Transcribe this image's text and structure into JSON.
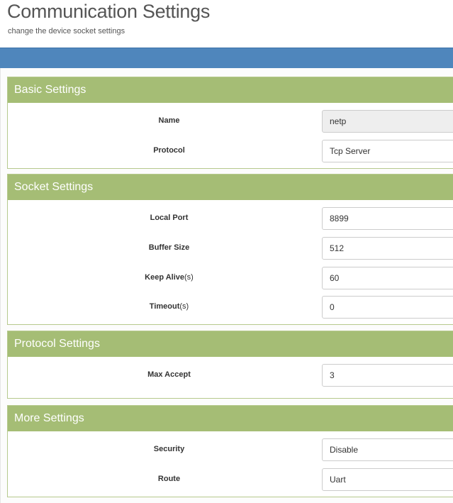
{
  "header": {
    "title": "Communication Settings",
    "subtitle": "change the device socket settings"
  },
  "basic": {
    "title": "Basic Settings",
    "name_label": "Name",
    "name_value": "netp",
    "protocol_label": "Protocol",
    "protocol_value": "Tcp Server"
  },
  "socket": {
    "title": "Socket Settings",
    "local_port_label": "Local Port",
    "local_port_value": "8899",
    "buffer_size_label": "Buffer Size",
    "buffer_size_value": "512",
    "keep_alive_label": "Keep Alive",
    "keep_alive_unit": "(s)",
    "keep_alive_value": "60",
    "timeout_label": "Timeout",
    "timeout_unit": "(s)",
    "timeout_value": "0"
  },
  "protocol": {
    "title": "Protocol Settings",
    "max_accept_label": "Max Accept",
    "max_accept_value": "3"
  },
  "more": {
    "title": "More Settings",
    "security_label": "Security",
    "security_value": "Disable",
    "route_label": "Route",
    "route_value": "Uart"
  },
  "colors": {
    "panel_header": "#a5bd75",
    "top_bar": "#4f86bc"
  }
}
